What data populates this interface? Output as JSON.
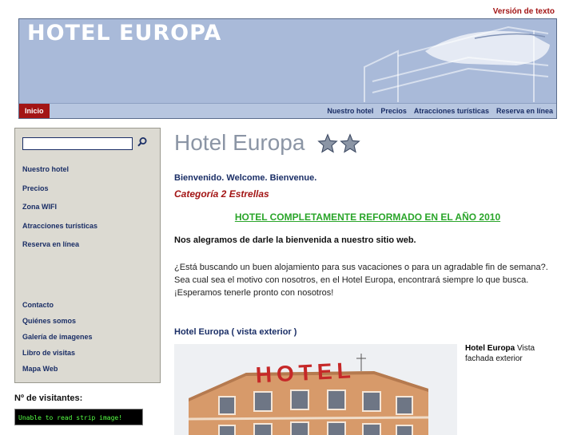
{
  "header": {
    "text_version_link": "Versión de texto",
    "banner_title": "HOTEL EUROPA",
    "home_tab": "Inicio",
    "nav_items": [
      "Nuestro hotel",
      "Precios",
      "Atracciones turísticas",
      "Reserva en línea"
    ]
  },
  "sidebar": {
    "search_value": "",
    "menu_top": [
      "Nuestro hotel",
      "Precios",
      "Zona WIFI",
      "Atracciones turísticas",
      "Reserva en línea"
    ],
    "menu_bottom": [
      "Contacto",
      "Quiénes somos",
      "Galería de imagenes",
      "Libro de visitas",
      "Mapa Web"
    ],
    "visits_label": "Nº de visitantes:",
    "counter_text": "Unable to read strip image!"
  },
  "main": {
    "title": "Hotel Europa",
    "star_count": 2,
    "welcome": "Bienvenido. Welcome. Bienvenue.",
    "category": "Categoría 2 Estrellas",
    "reformed": "HOTEL COMPLETAMENTE REFORMADO EN EL AÑO 2010",
    "intro": "Nos alegramos de darle la bienvenida a nuestro sitio web.",
    "paragraph": "¿Está buscando un buen alojamiento para sus vacaciones o para un agradable fin de semana?. Sea cual sea el motivo con nosotros, en el Hotel Europa, encontrará siempre lo que busca. ¡Esperamos tenerle pronto con nosotros!",
    "section_title": "Hotel Europa ( vista exterior )",
    "photo_sign": "HOTEL",
    "caption_bold": "Hotel Europa",
    "caption_text": " Vista fachada exterior"
  },
  "colors": {
    "accent_red": "#a31515",
    "nav_blue": "#1a2e66",
    "banner_bg": "#a9bad9",
    "sidebar_bg": "#dcdad2",
    "highlight_green": "#2aa52a"
  },
  "icons": {
    "search": "search-icon",
    "star": "star-icon",
    "bed": "bed-illustration"
  }
}
